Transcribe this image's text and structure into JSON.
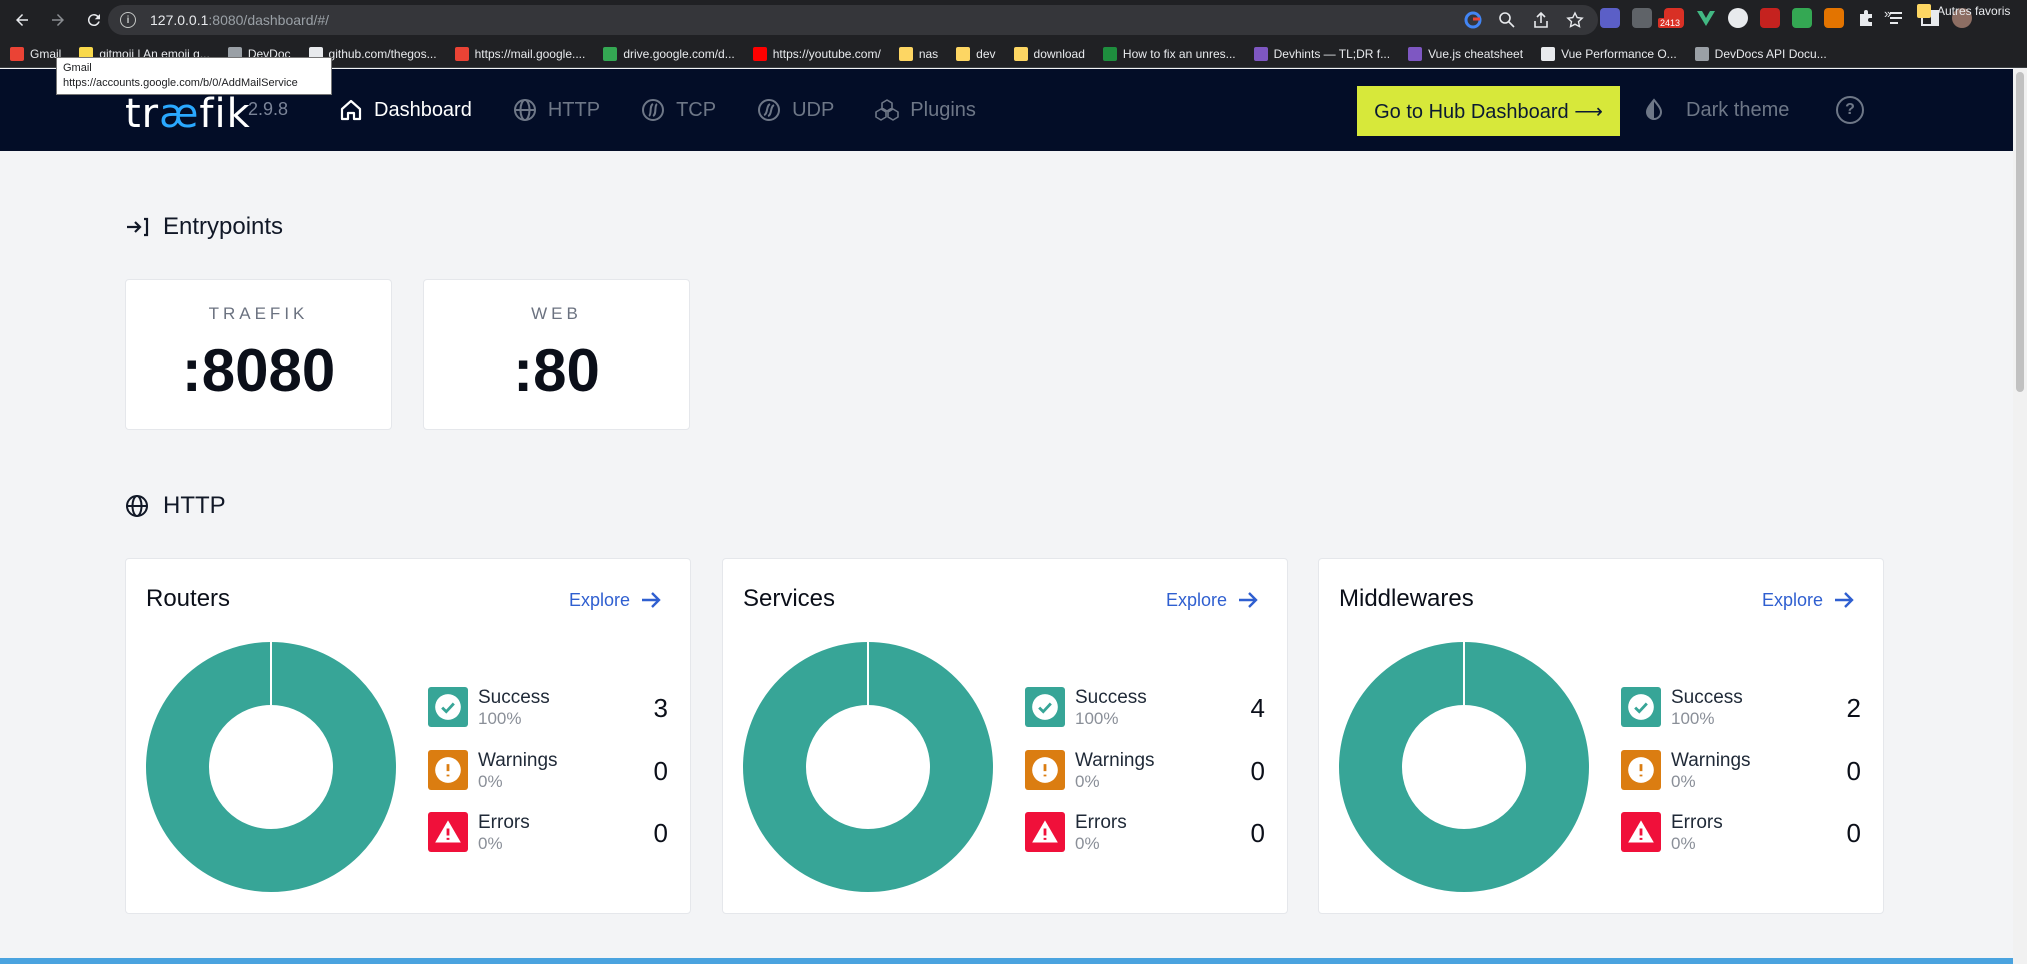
{
  "browser": {
    "url_host": "127.0.0.1",
    "url_rest": ":8080/dashboard/#/",
    "extension_badge": "2413",
    "bookmarks": [
      {
        "label": "Gmail",
        "color": "#ea4335"
      },
      {
        "label": "gitmoji | An emoji g...",
        "color": "#f9d94b"
      },
      {
        "label": "DevDoc",
        "color": "#9aa0a6"
      },
      {
        "label": "github.com/thegos...",
        "color": "#e8eaed"
      },
      {
        "label": "https://mail.google....",
        "color": "#ea4335"
      },
      {
        "label": "drive.google.com/d...",
        "color": "#34a853"
      },
      {
        "label": "https://youtube.com/",
        "color": "#ff0000"
      },
      {
        "label": "nas",
        "color": "#fdd663"
      },
      {
        "label": "dev",
        "color": "#fdd663"
      },
      {
        "label": "download",
        "color": "#fdd663"
      },
      {
        "label": "How to fix an unres...",
        "color": "#1e8e3e"
      },
      {
        "label": "Devhints — TL;DR f...",
        "color": "#7e57c2"
      },
      {
        "label": "Vue.js cheatsheet",
        "color": "#7e57c2"
      },
      {
        "label": "Vue Performance O...",
        "color": "#e8eaed"
      },
      {
        "label": "DevDocs API Docu...",
        "color": "#9aa0a6"
      }
    ],
    "bookmarks_more": "»",
    "other_bookmarks": "Autres favoris",
    "tooltip_title": "Gmail",
    "tooltip_url": "https://accounts.google.com/b/0/AddMailService"
  },
  "header": {
    "logo_pre": "tr",
    "logo_ae": "æ",
    "logo_post": "fik",
    "version": "2.9.8",
    "nav": [
      {
        "label": "Dashboard",
        "icon": "home-icon",
        "active": true
      },
      {
        "label": "HTTP",
        "icon": "globe-icon",
        "active": false
      },
      {
        "label": "TCP",
        "icon": "tcp-icon",
        "active": false
      },
      {
        "label": "UDP",
        "icon": "udp-icon",
        "active": false
      },
      {
        "label": "Plugins",
        "icon": "cubes-icon",
        "active": false
      }
    ],
    "hub_button": "Go to Hub Dashboard ⟶",
    "theme_toggle": "Dark theme",
    "help": "?"
  },
  "entrypoints": {
    "title": "Entrypoints",
    "items": [
      {
        "name": "TRAEFIK",
        "port": ":8080"
      },
      {
        "name": "WEB",
        "port": ":80"
      }
    ]
  },
  "http": {
    "title": "HTTP",
    "explore_label": "Explore",
    "cards": [
      {
        "title": "Routers",
        "success": {
          "label": "Success",
          "pct": "100%",
          "count": "3"
        },
        "warnings": {
          "label": "Warnings",
          "pct": "0%",
          "count": "0"
        },
        "errors": {
          "label": "Errors",
          "pct": "0%",
          "count": "0"
        }
      },
      {
        "title": "Services",
        "success": {
          "label": "Success",
          "pct": "100%",
          "count": "4"
        },
        "warnings": {
          "label": "Warnings",
          "pct": "0%",
          "count": "0"
        },
        "errors": {
          "label": "Errors",
          "pct": "0%",
          "count": "0"
        }
      },
      {
        "title": "Middlewares",
        "success": {
          "label": "Success",
          "pct": "100%",
          "count": "2"
        },
        "warnings": {
          "label": "Warnings",
          "pct": "0%",
          "count": "0"
        },
        "errors": {
          "label": "Errors",
          "pct": "0%",
          "count": "0"
        }
      }
    ]
  },
  "colors": {
    "success": "#37a597",
    "warning": "#db7d11",
    "error": "#f0103a",
    "header_bg": "#030d27",
    "hub_button": "#d7e83a"
  }
}
